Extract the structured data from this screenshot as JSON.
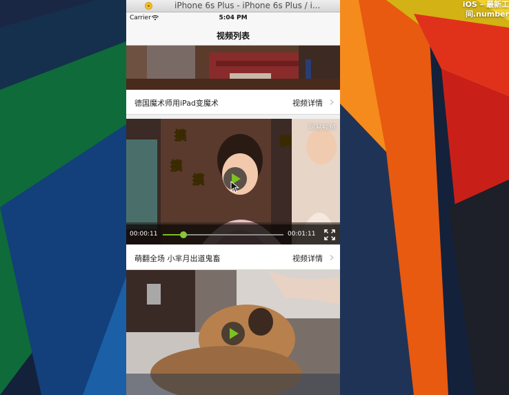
{
  "window": {
    "title": "iPhone 6s Plus - iPhone 6s Plus / i..."
  },
  "desktop": {
    "notice_line1": "iOS – 最新工",
    "notice_line2": "间.number"
  },
  "status_bar": {
    "carrier": "Carrier",
    "time": "5:04 PM",
    "wifi_icon": "wifi-icon"
  },
  "nav": {
    "title": "视频列表"
  },
  "videos": [
    {
      "title": "德国魔术师用iPad变魔术",
      "detail": "视频详情",
      "detail_icon": "chevron-right-icon"
    },
    {
      "watermark": "网易视频",
      "stickers": [
        "摸",
        "摸",
        "摸",
        "摸"
      ],
      "player": {
        "current_time": "00:00:11",
        "total_time": "00:01:11",
        "progress": 0.17,
        "fullscreen_icon": "fullscreen-icon",
        "play_icon": "play-icon"
      },
      "title": "萌翻全场 小芈月出道鬼畜",
      "detail": "视频详情",
      "detail_icon": "chevron-right-icon"
    },
    {
      "play_icon": "play-icon"
    }
  ],
  "colors": {
    "accent": "#7cc21f"
  }
}
